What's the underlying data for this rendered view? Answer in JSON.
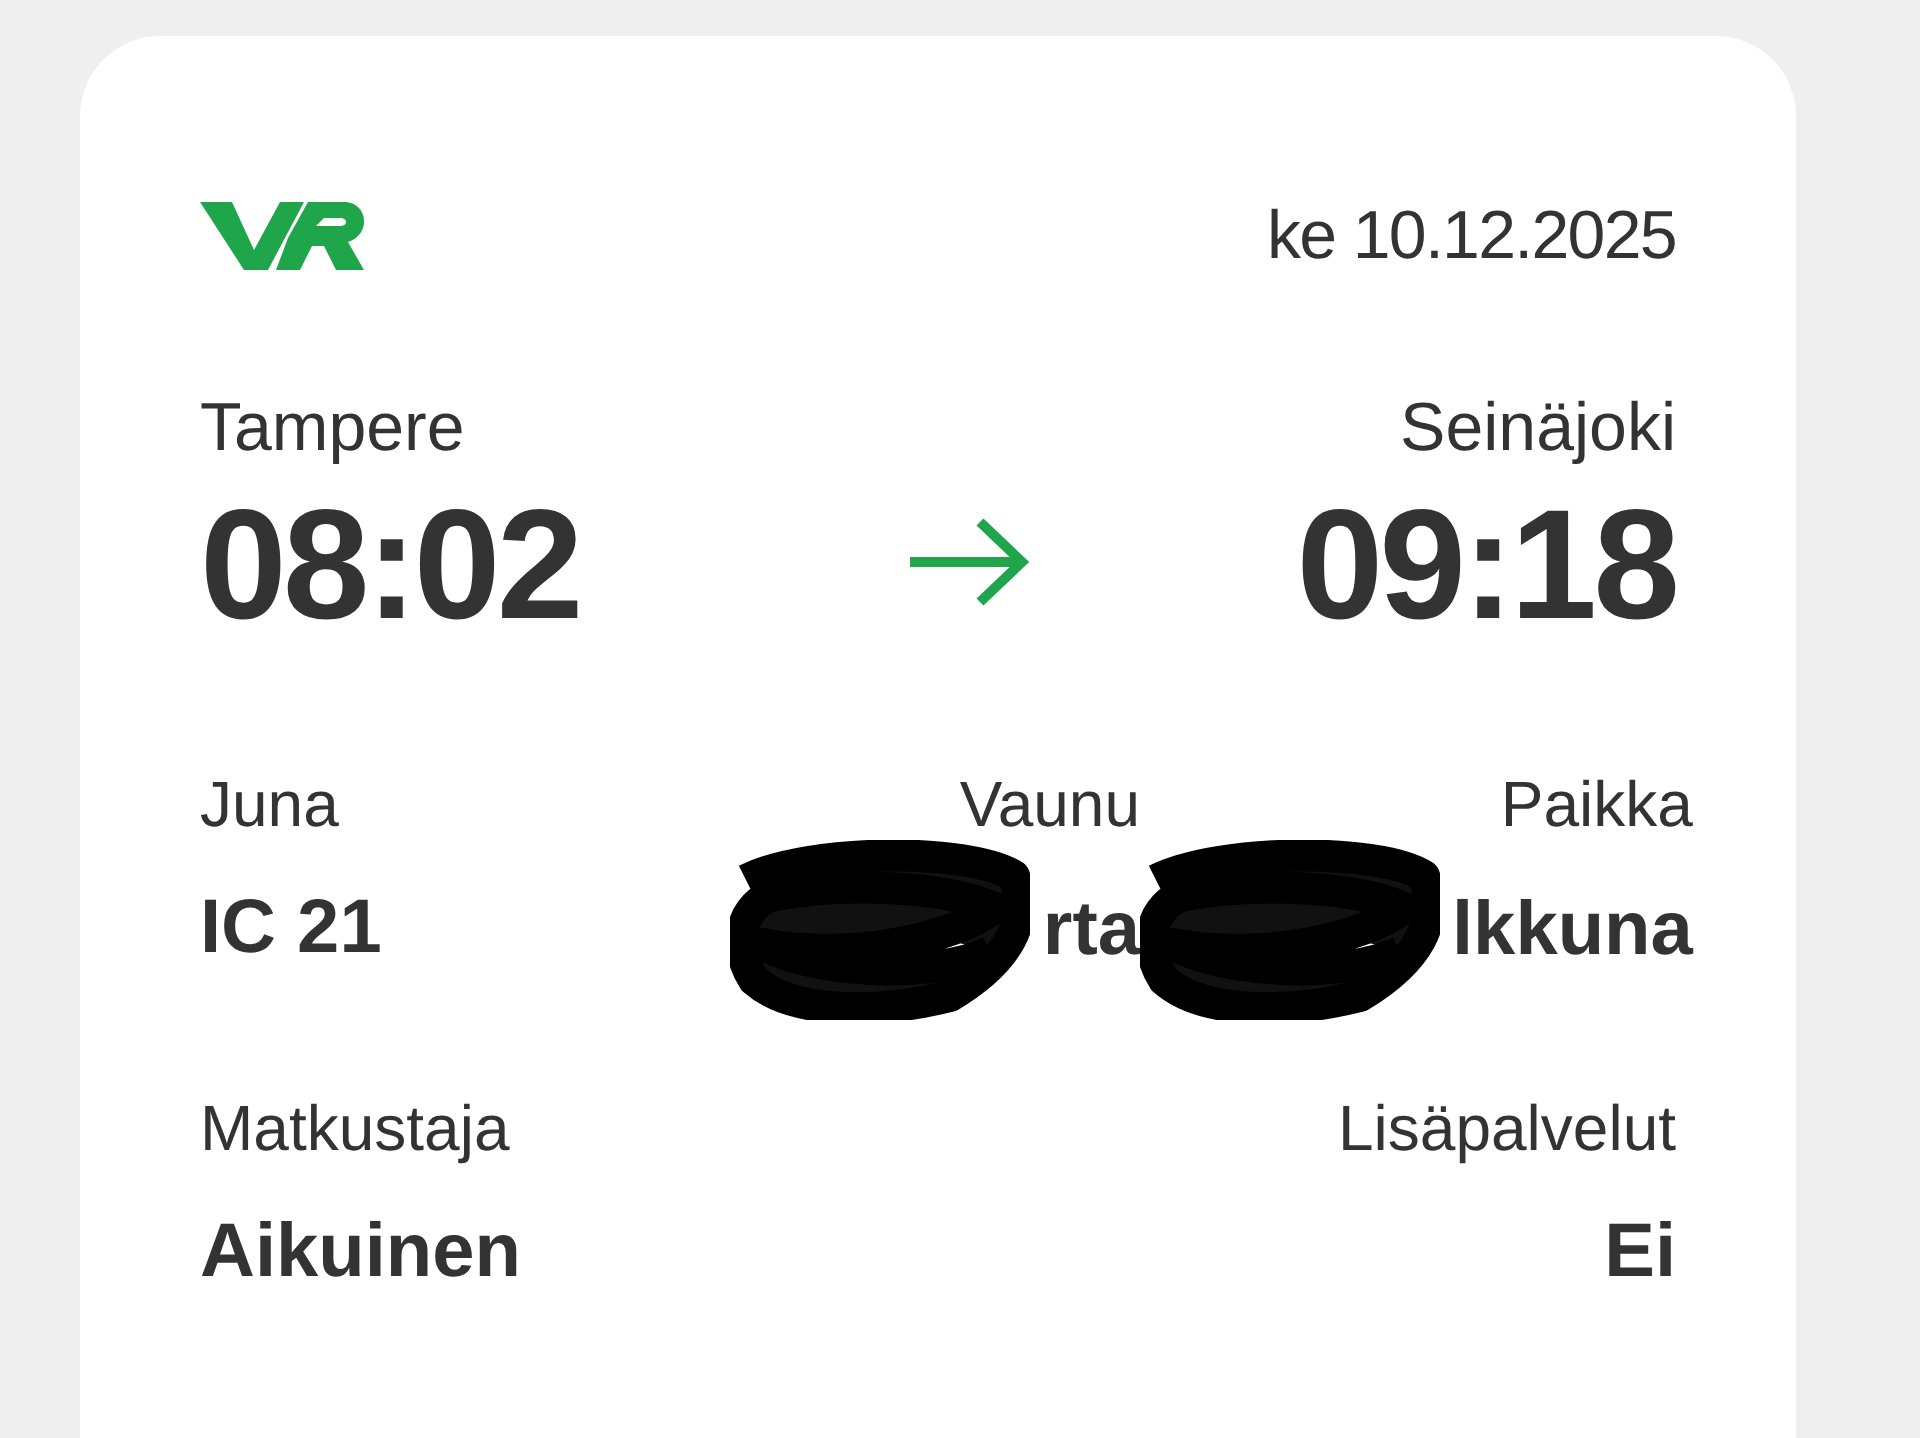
{
  "header": {
    "date": "ke 10.12.2025"
  },
  "journey": {
    "from": {
      "station": "Tampere",
      "time": "08:02"
    },
    "to": {
      "station": "Seinäjoki",
      "time": "09:18"
    }
  },
  "details": [
    {
      "label": "Juna",
      "value": "IC 21",
      "scribbled": false
    },
    {
      "label": "Vaunu",
      "value": "rta",
      "scribbled": true
    },
    {
      "label": "Paikka",
      "value": "lkkuna",
      "scribbled": true
    }
  ],
  "passenger": [
    {
      "label": "Matkustaja",
      "value": "Aikuinen"
    },
    {
      "label": "Lisäpalvelut",
      "value": "Ei"
    }
  ]
}
